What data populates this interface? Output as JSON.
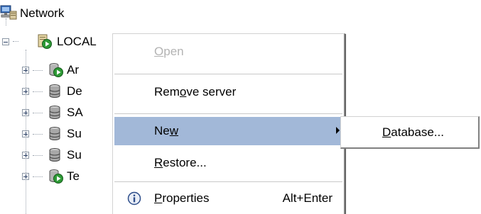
{
  "tree": {
    "root_label": "Network",
    "server_label": "LOCAL",
    "children": [
      {
        "label": "Ar",
        "icon": "green-play-database-icon"
      },
      {
        "label": "De",
        "icon": "gray-database-icon"
      },
      {
        "label": "SA",
        "icon": "gray-database-icon"
      },
      {
        "label": "Su",
        "icon": "gray-database-icon"
      },
      {
        "label": "Su",
        "icon": "gray-database-icon"
      },
      {
        "label": "Te",
        "icon": "green-play-database-icon"
      }
    ]
  },
  "context_menu": {
    "open": {
      "pre": "",
      "accel": "O",
      "post": "pen",
      "enabled": false
    },
    "remove_server": {
      "pre": "Rem",
      "accel": "o",
      "post": "ve server"
    },
    "new": {
      "pre": "Ne",
      "accel": "w",
      "post": "",
      "highlighted": true
    },
    "restore": {
      "pre": "",
      "accel": "R",
      "post": "estore..."
    },
    "properties": {
      "pre": "",
      "accel": "P",
      "post": "roperties",
      "shortcut": "Alt+Enter",
      "icon": "info-icon"
    }
  },
  "submenu": {
    "database": {
      "pre": "",
      "accel": "D",
      "post": "atabase..."
    }
  },
  "colors": {
    "highlight": "#a2b8d8",
    "disabled_text": "#b3b3b3"
  }
}
